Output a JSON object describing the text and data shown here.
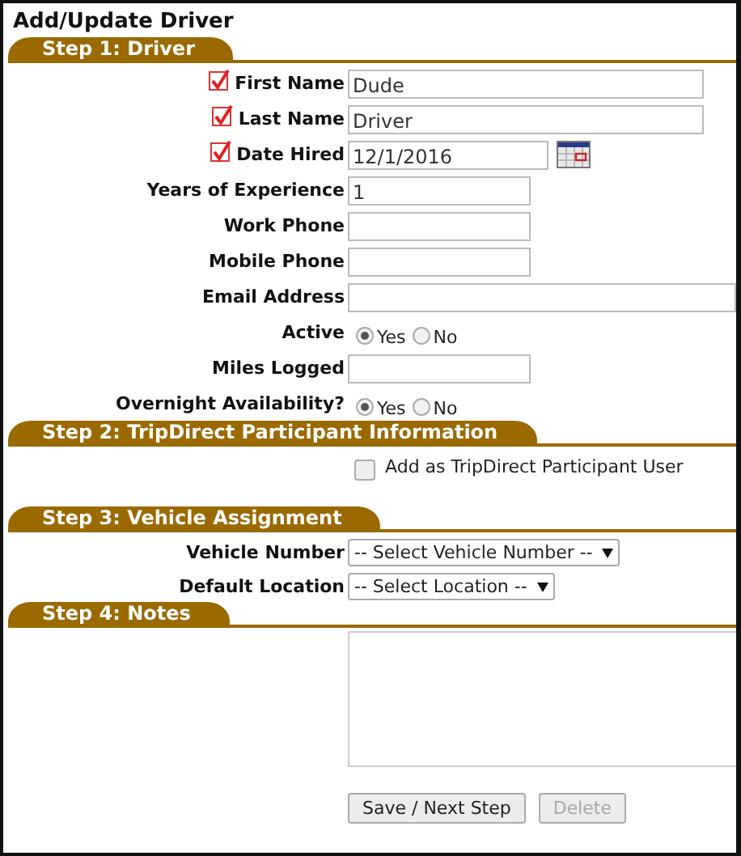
{
  "title": "Add/Update Driver",
  "sections": [
    {
      "kind": "fields",
      "title": "Step 1: Driver",
      "fields": [
        {
          "kind": "name",
          "label": "First Name",
          "value": "Dude",
          "required": true
        },
        {
          "kind": "name",
          "label": "Last Name",
          "value": "Driver",
          "required": true
        },
        {
          "kind": "date",
          "label": "Date Hired",
          "value": "12/1/2016",
          "required": true
        },
        {
          "kind": "number",
          "label": "Years of Experience",
          "value": "1",
          "required": false
        },
        {
          "kind": "number",
          "label": "Work Phone",
          "required": false
        },
        {
          "kind": "number",
          "label": "Mobile Phone",
          "required": false
        },
        {
          "kind": "email",
          "label": "Email Address",
          "required": false
        },
        {
          "kind": "radio",
          "label": "Active",
          "options": [
            {
              "label": "Yes",
              "selected": true
            },
            {
              "label": "No",
              "selected": false
            }
          ]
        },
        {
          "kind": "number",
          "label": "Miles Logged",
          "required": false
        },
        {
          "kind": "radio",
          "label": "Overnight Availability?",
          "options": [
            {
              "label": "Yes",
              "selected": true
            },
            {
              "label": "No",
              "selected": false
            }
          ]
        }
      ]
    },
    {
      "kind": "checkbox",
      "title": "Step 2: TripDirect Participant Information",
      "label": "Add as TripDirect Participant User",
      "checked": false
    },
    {
      "kind": "fields",
      "title": "Step 3: Vehicle Assignment",
      "fields": [
        {
          "kind": "select",
          "label": "Vehicle Number",
          "value": "-- Select Vehicle Number --"
        },
        {
          "kind": "select",
          "label": "Default Location",
          "value": "-- Select Location --"
        }
      ]
    },
    {
      "kind": "notes",
      "title": "Step 4: Notes"
    }
  ],
  "buttons": [
    {
      "label": "Save / Next Step",
      "disabled": false
    },
    {
      "label": "Delete",
      "disabled": true
    }
  ]
}
